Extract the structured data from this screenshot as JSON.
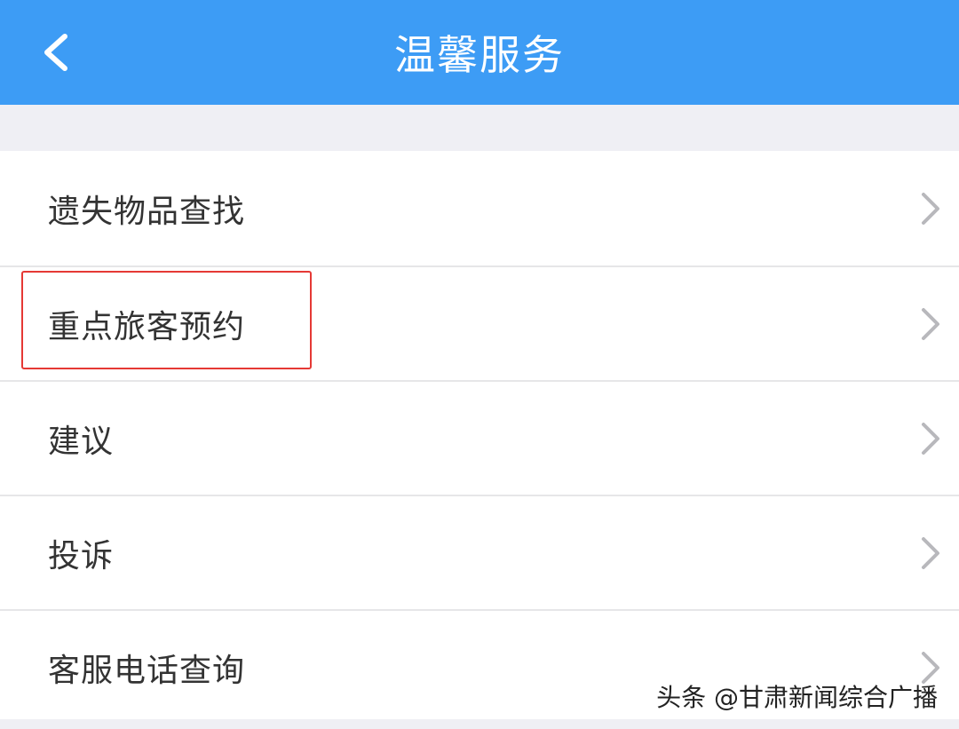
{
  "navbar": {
    "title": "温馨服务",
    "back_icon": "chevron-left-icon",
    "background_color": "#3d9cf5"
  },
  "menu": {
    "items": [
      {
        "label": "遗失物品查找"
      },
      {
        "label": "重点旅客预约"
      },
      {
        "label": "建议"
      },
      {
        "label": "投诉"
      },
      {
        "label": "客服电话查询"
      }
    ],
    "arrow_icon": "chevron-right-icon"
  },
  "highlight": {
    "target": "重点旅客预约",
    "color": "#e53935"
  },
  "watermark": {
    "text": "头条 @甘肃新闻综合广播"
  }
}
